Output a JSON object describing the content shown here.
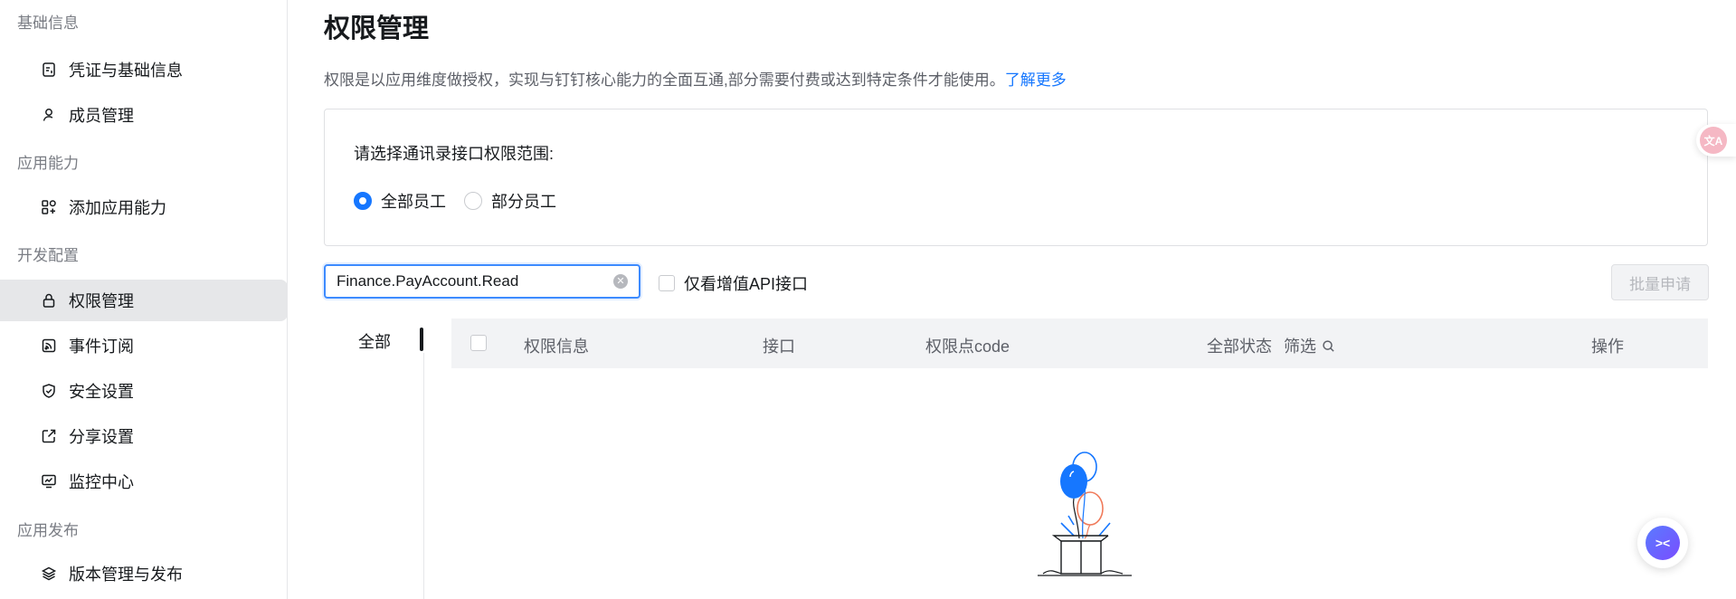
{
  "sidebar": {
    "groups": [
      {
        "label": "基础信息"
      },
      {
        "label": "应用能力"
      },
      {
        "label": "开发配置"
      },
      {
        "label": "应用发布"
      }
    ],
    "items": [
      {
        "label": "凭证与基础信息",
        "icon": "credential-icon"
      },
      {
        "label": "成员管理",
        "icon": "user-icon"
      },
      {
        "label": "添加应用能力",
        "icon": "apps-icon"
      },
      {
        "label": "权限管理",
        "icon": "lock-icon",
        "active": true
      },
      {
        "label": "事件订阅",
        "icon": "rss-icon"
      },
      {
        "label": "安全设置",
        "icon": "shield-icon"
      },
      {
        "label": "分享设置",
        "icon": "share-icon"
      },
      {
        "label": "监控中心",
        "icon": "monitor-icon"
      },
      {
        "label": "版本管理与发布",
        "icon": "layers-icon"
      }
    ]
  },
  "main": {
    "title": "权限管理",
    "description": "权限是以应用维度做授权，实现与钉钉核心能力的全面互通,部分需要付费或达到特定条件才能使用。",
    "learn_more": "了解更多",
    "scope": {
      "label": "请选择通讯录接口权限范围:",
      "options": [
        {
          "label": "全部员工",
          "checked": true
        },
        {
          "label": "部分员工",
          "checked": false
        }
      ]
    },
    "search": {
      "value": "Finance.PayAccount.Read"
    },
    "value_added_only": {
      "label": "仅看增值API接口",
      "checked": false
    },
    "batch_apply": "批量申请",
    "category_tab": "全部",
    "table": {
      "columns": {
        "info": "权限信息",
        "api": "接口",
        "code": "权限点code",
        "status": "全部状态",
        "filter": "筛选",
        "action": "操作"
      },
      "rows": []
    }
  },
  "colors": {
    "accent": "#1677ff",
    "sidebar_active_bg": "#e6e7e9",
    "table_head_bg": "#f2f3f5"
  },
  "floating": {
    "translate_icon": "translate-icon",
    "assistant_icon": "assistant-icon"
  }
}
